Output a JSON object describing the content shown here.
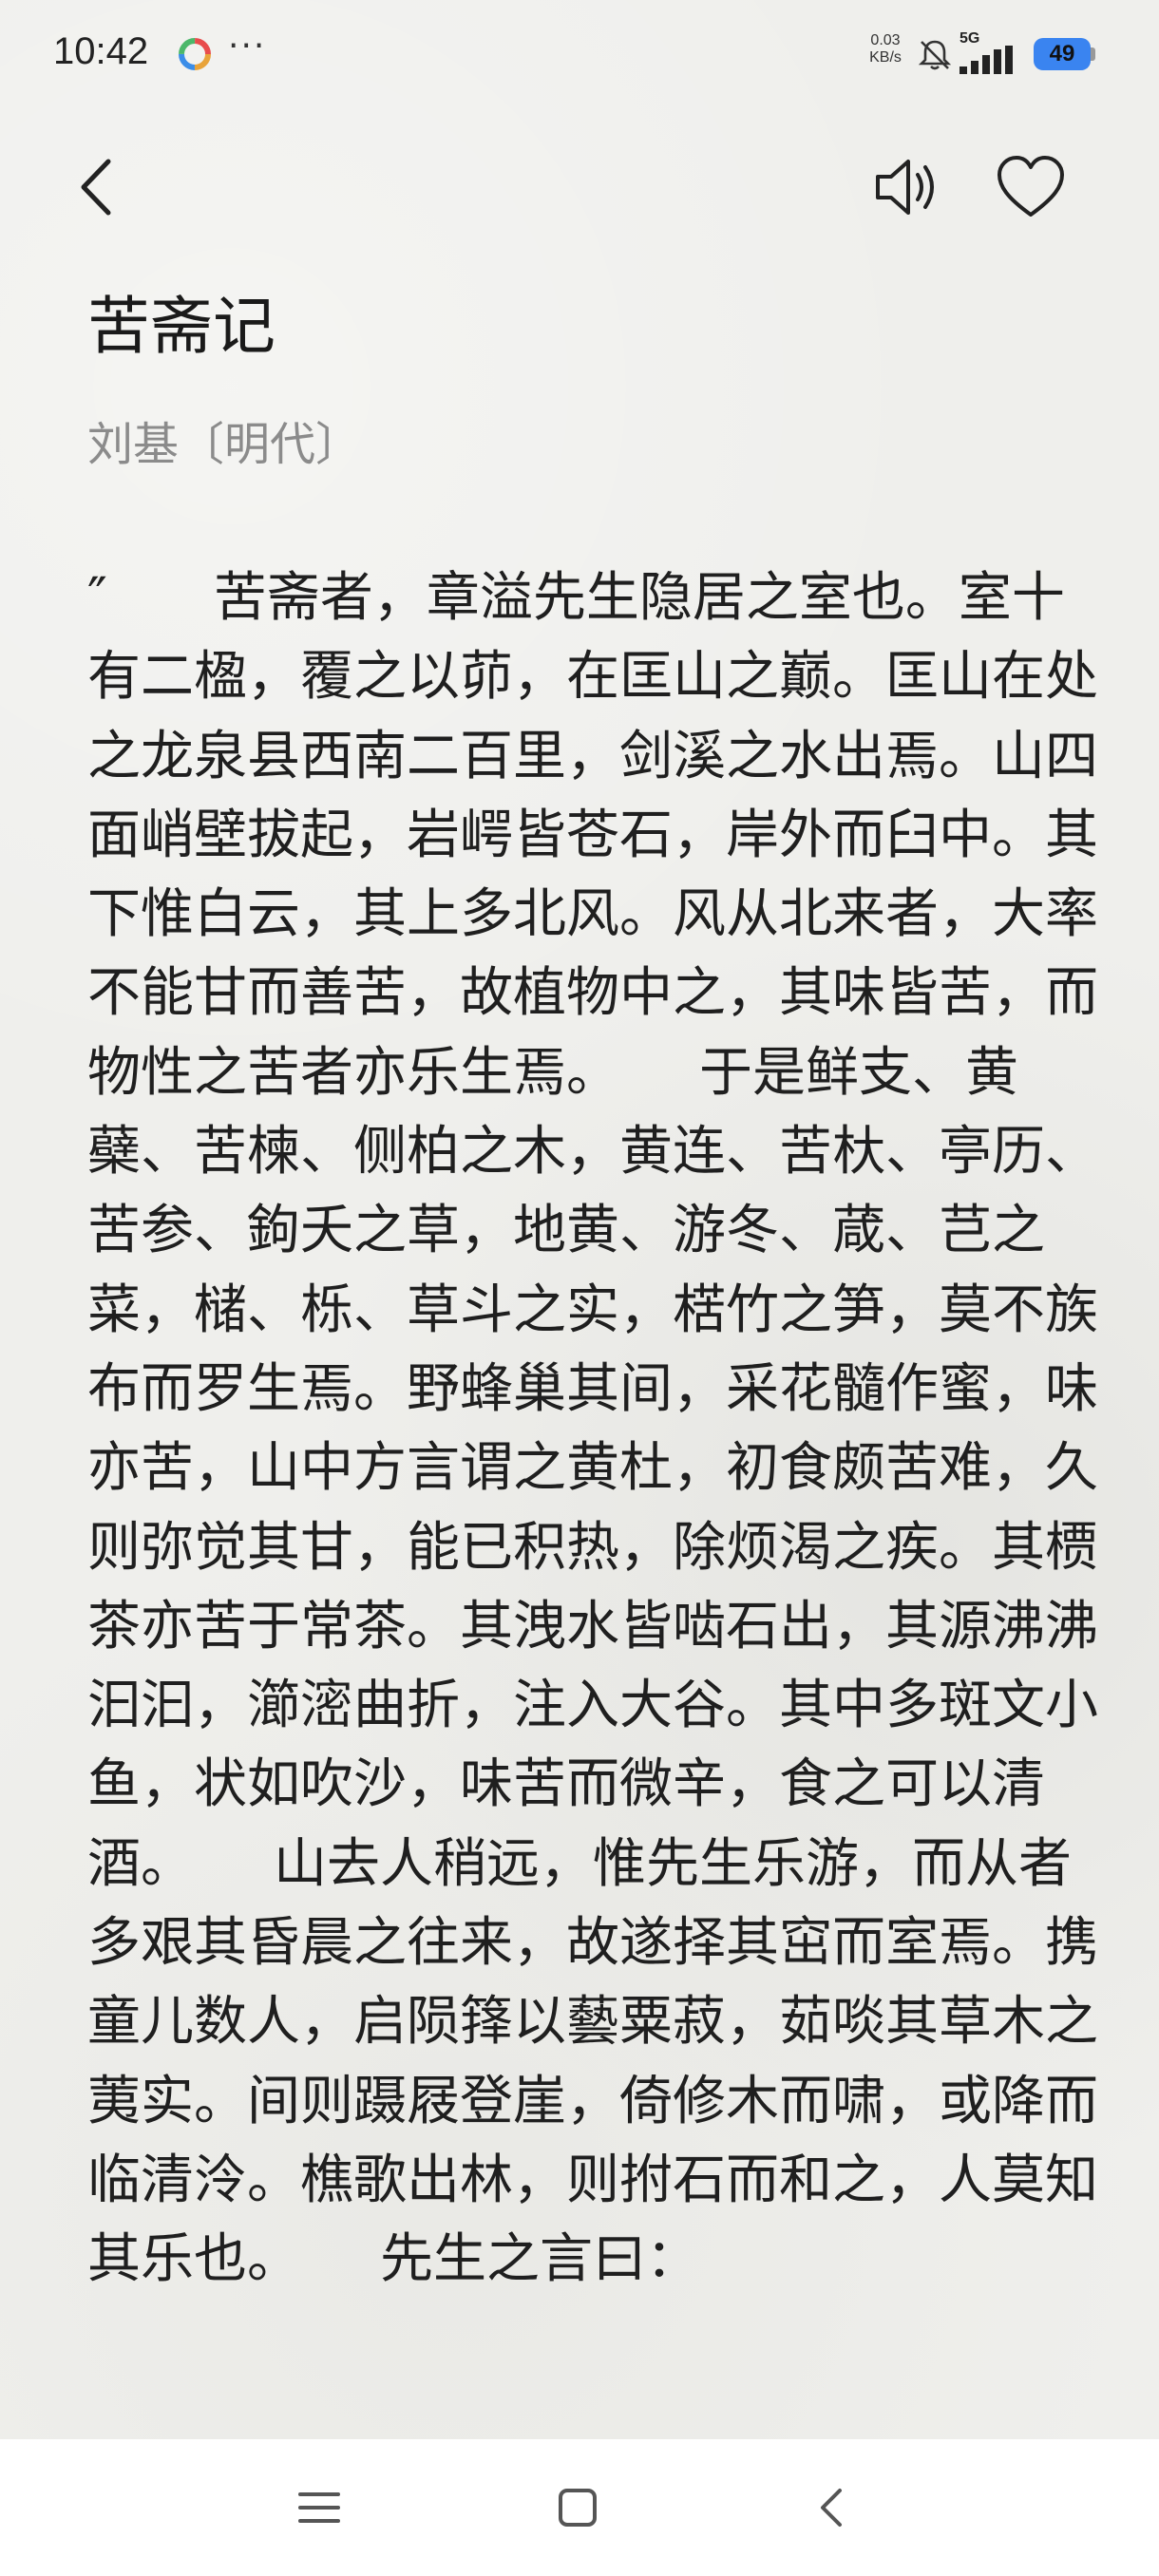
{
  "status": {
    "time": "10:42",
    "more": "···",
    "net_speed_value": "0.03",
    "net_speed_unit": "KB/s",
    "signal_label": "5G",
    "battery": "49"
  },
  "article": {
    "title": "苦斋记",
    "author": "刘基〔明代〕",
    "body": "″　　苦斋者，章溢先生隐居之室也。室十有二楹，覆之以茆，在匡山之巅。匡山在处之龙泉县西南二百里，剑溪之水出焉。山四面峭壁拔起，岩崿皆苍石，岸外而臼中。其下惟白云，其上多北风。风从北来者，大率不能甘而善苦，故植物中之，其味皆苦，而物性之苦者亦乐生焉。　　于是鲜支、黄蘗、苦楝、侧柏之木，黄连、苦杕、亭历、苦参、鉤夭之草，地黄、游冬、葴、芑之菜，槠、栎、草斗之实，楛竹之笋，莫不族布而罗生焉。野蜂巢其间，采花髓作蜜，味亦苦，山中方言谓之黄杜，初食颇苦难，久则弥觉其甘，能已积热，除烦渴之疾。其槚茶亦苦于常茶。其洩水皆啮石出，其源沸沸汩汩，瀄滵曲折，注入大谷。其中多斑文小鱼，状如吹沙，味苦而微辛，食之可以清酒。　　山去人稍远，惟先生乐游，而从者多艰其昏晨之往来，故遂择其窋而室焉。携童儿数人，启陨箨以藝粟菽，茹啖其草木之荑实。间则蹑屐登崖，倚修木而啸，或降而临清泠。樵歌出林，则拊石而和之，人莫知其乐也。　　先生之言曰："
  },
  "icons": {
    "back": "back-arrow-icon",
    "speaker": "speaker-icon",
    "favorite": "heart-icon",
    "menu": "menu-icon",
    "home": "home-icon",
    "nav_back": "nav-back-icon"
  }
}
